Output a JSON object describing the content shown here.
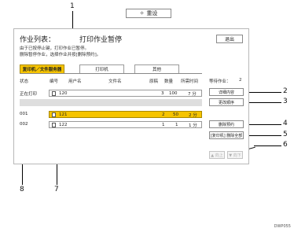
{
  "reset_button": {
    "icon": "star-icon",
    "label": "重设"
  },
  "screen": {
    "title": "作业列表：",
    "subtitle": "打印作业暂停",
    "exit_label": "退出",
    "description_line1": "由于已按停止键，打印作业已暂停。",
    "description_line2": "删除暂停作业，选择作业并按[删除预约]。"
  },
  "tabs": [
    {
      "label": "复印机／文件服务器",
      "active": true
    },
    {
      "label": "打印机",
      "active": false
    },
    {
      "label": "其他",
      "active": false
    }
  ],
  "header": {
    "status": "状态",
    "number": "编号",
    "user": "用户名",
    "filename": "文件名",
    "originals": "原稿",
    "quantity": "数量",
    "time": "所需时间",
    "waiting_label": "等待作业：",
    "waiting_count": "2"
  },
  "rows": [
    {
      "status": "正在打印",
      "no": "120",
      "originals": "3",
      "qty": "100",
      "time": "7 分",
      "selected": false
    },
    {
      "status": "001",
      "no": "121",
      "originals": "2",
      "qty": "50",
      "time": "2 分",
      "selected": true
    },
    {
      "status": "002",
      "no": "122",
      "originals": "1",
      "qty": "1",
      "time": "1 分",
      "selected": false
    }
  ],
  "side_buttons": {
    "details": "详细内容",
    "change_order": "更改顺序",
    "delete_reservation": "删除预约",
    "delete_all": "[复印机] 删除全部"
  },
  "pagination": {
    "prev": "▲ 向上",
    "next": "▼ 向下"
  },
  "callouts": [
    "1",
    "2",
    "3",
    "4",
    "5",
    "6",
    "7",
    "8"
  ],
  "watermark": "DWP055"
}
